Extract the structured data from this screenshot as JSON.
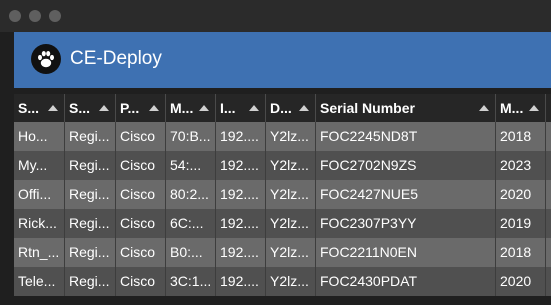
{
  "app": {
    "title": "CE-Deploy"
  },
  "table": {
    "columns": [
      "S...",
      "S...",
      "P...",
      "M...",
      "I...",
      "D...",
      "Serial Number",
      "M...",
      ""
    ],
    "rows": [
      [
        "Ho...",
        "Regi...",
        "Cisco",
        "70:B...",
        "192....",
        "Y2lz...",
        "FOC2245ND8T",
        "2018",
        ""
      ],
      [
        "My...",
        "Regi...",
        "Cisco",
        "54:...",
        "192....",
        "Y2lz...",
        "FOC2702N9ZS",
        "2023",
        ""
      ],
      [
        "Offi...",
        "Regi...",
        "Cisco",
        "80:2...",
        "192....",
        "Y2lz...",
        "FOC2427NUE5",
        "2020",
        ""
      ],
      [
        "Rick...",
        "Regi...",
        "Cisco",
        "6C:...",
        "192....",
        "Y2lz...",
        "FOC2307P3YY",
        "2019",
        ""
      ],
      [
        "Rtn_...",
        "Regi...",
        "Cisco",
        "B0:...",
        "192....",
        "Y2lz...",
        "FOC2211N0EN",
        "2018",
        ""
      ],
      [
        "Tele...",
        "Regi...",
        "Cisco",
        "3C:1...",
        "192....",
        "Y2lz...",
        "FOC2430PDAT",
        "2020",
        ""
      ]
    ]
  }
}
